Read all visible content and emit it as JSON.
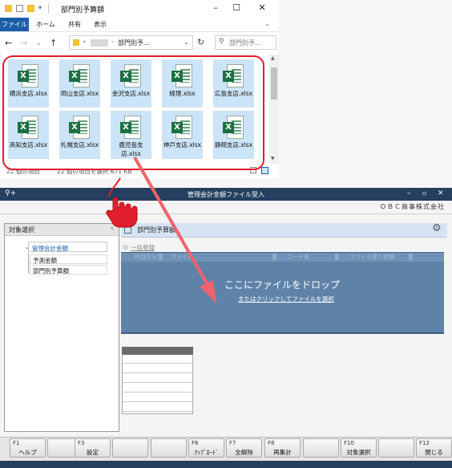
{
  "explorer": {
    "title": "部門別予算額",
    "ribbon_tabs": [
      "ファイル",
      "ホーム",
      "共有",
      "表示"
    ],
    "address_path": "部門別予...",
    "search_placeholder": "部門別予...",
    "files": [
      {
        "label": "横浜支店.xlsx"
      },
      {
        "label": "岡山支店.xlsx"
      },
      {
        "label": "金沢支店.xlsx"
      },
      {
        "label": "経理.xlsx"
      },
      {
        "label": "広島支店.xlsx"
      },
      {
        "label": "高知支店.xlsx"
      },
      {
        "label": "札幌支店.xlsx"
      },
      {
        "label": "鹿児島支店.xlsx"
      },
      {
        "label": "神戸支店.xlsx"
      },
      {
        "label": "静岡支店.xlsx"
      }
    ],
    "status": {
      "count": "22 個の項目",
      "selected": "22 個の項目を選択 671 KB"
    }
  },
  "app": {
    "title": "管理会計金額ファイル受入",
    "company": "ＯＢＣ商事株式会社",
    "left_panel": {
      "title": "対象選択",
      "tree_root": "管理会計金額",
      "tree_items": [
        "予測金額",
        "部門別予算額"
      ]
    },
    "right_panel": {
      "title": "部門別予算額",
      "bulk_register": "一括登録",
      "columns": [
        "科目区分",
        "ファイル",
        "コード名",
        "ファイル受入状態"
      ],
      "drop_text": "ここにファイルをドロップ",
      "drop_link": "またはクリックしてファイルを選択"
    },
    "fkeys": [
      {
        "key": "F1",
        "label": "ヘルプ"
      },
      {
        "key": "",
        "label": ""
      },
      {
        "key": "F3",
        "label": "設定"
      },
      {
        "key": "",
        "label": ""
      },
      {
        "key": "",
        "label": ""
      },
      {
        "key": "F6",
        "label": "ｱｯﾌﾟﾛｰﾄﾞ"
      },
      {
        "key": "F7",
        "label": "全解除"
      },
      {
        "key": "F8",
        "label": "再集計"
      },
      {
        "key": "",
        "label": ""
      },
      {
        "key": "F10",
        "label": "対象選択"
      },
      {
        "key": "",
        "label": ""
      },
      {
        "key": "F12",
        "label": "閉じる"
      }
    ]
  },
  "colors": {
    "accent": "#e01e2c",
    "window_title": "#243f5f",
    "drop_zone": "#5f83a8"
  }
}
